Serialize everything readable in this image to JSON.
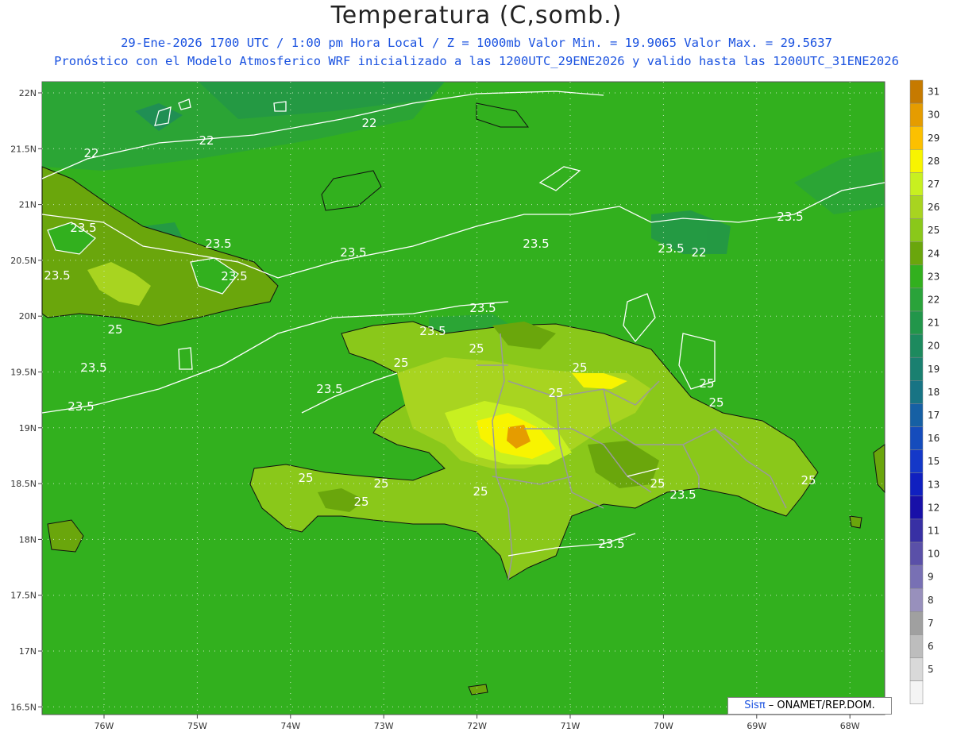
{
  "title": "Temperatura (C,somb.)",
  "subtitle_line1": "29-Ene-2026  1700 UTC / 1:00 pm Hora Local / Z = 1000mb   Valor Min. = 19.9065  Valor Max. = 29.5637",
  "subtitle_line2": "Pronóstico con el Modelo Atmosferico WRF inicializado a las 1200UTC_29ENE2026 y valido hasta las  1200UTC_31ENE2026",
  "credit": {
    "brand": "Sisπ",
    "text": " – ONAMET/REP.DOM."
  },
  "latitude_labels": [
    "22N",
    "21.5N",
    "21N",
    "20.5N",
    "20N",
    "19.5N",
    "19N",
    "18.5N",
    "18N",
    "17.5N",
    "17N",
    "16.5N"
  ],
  "longitude_labels": [
    "76W",
    "75W",
    "74W",
    "73W",
    "72W",
    "71W",
    "70W",
    "69W",
    "68W"
  ],
  "colorbar": {
    "levels": [
      {
        "label": "31",
        "color": "#c67a00"
      },
      {
        "label": "30",
        "color": "#e59c00"
      },
      {
        "label": "29",
        "color": "#fcc000"
      },
      {
        "label": "28",
        "color": "#f8f400"
      },
      {
        "label": "27",
        "color": "#c8f020"
      },
      {
        "label": "26",
        "color": "#a8d420"
      },
      {
        "label": "25",
        "color": "#8ac81a"
      },
      {
        "label": "24",
        "color": "#6aa60c"
      },
      {
        "label": "23",
        "color": "#32b01e"
      },
      {
        "label": "22",
        "color": "#2aa33a"
      },
      {
        "label": "21",
        "color": "#22964a"
      },
      {
        "label": "20",
        "color": "#1d8a5e"
      },
      {
        "label": "19",
        "color": "#1a8070"
      },
      {
        "label": "18",
        "color": "#187484"
      },
      {
        "label": "17",
        "color": "#1660a4"
      },
      {
        "label": "16",
        "color": "#154cbc"
      },
      {
        "label": "15",
        "color": "#1438c8"
      },
      {
        "label": "13",
        "color": "#1020c0"
      },
      {
        "label": "12",
        "color": "#1810a8"
      },
      {
        "label": "11",
        "color": "#3830a4"
      },
      {
        "label": "10",
        "color": "#5a50a8"
      },
      {
        "label": "9",
        "color": "#7870b4"
      },
      {
        "label": "8",
        "color": "#9890bc"
      },
      {
        "label": "7",
        "color": "#a0a0a0"
      },
      {
        "label": "6",
        "color": "#bdbdbd"
      },
      {
        "label": "5",
        "color": "#d9d9d9"
      },
      {
        "label": "",
        "color": "#f4f4f4"
      }
    ]
  },
  "contour_labels": [
    "22",
    "22",
    "22",
    "22",
    "23.5",
    "23.5",
    "23.5",
    "23.5",
    "23.5",
    "23.5",
    "23.5",
    "23.5",
    "23.5",
    "23.5",
    "23.5",
    "23.5",
    "23.5",
    "23.5",
    "23.5",
    "25",
    "25",
    "25",
    "25",
    "25",
    "25",
    "25",
    "25",
    "25",
    "25",
    "25",
    "25",
    "25"
  ]
}
